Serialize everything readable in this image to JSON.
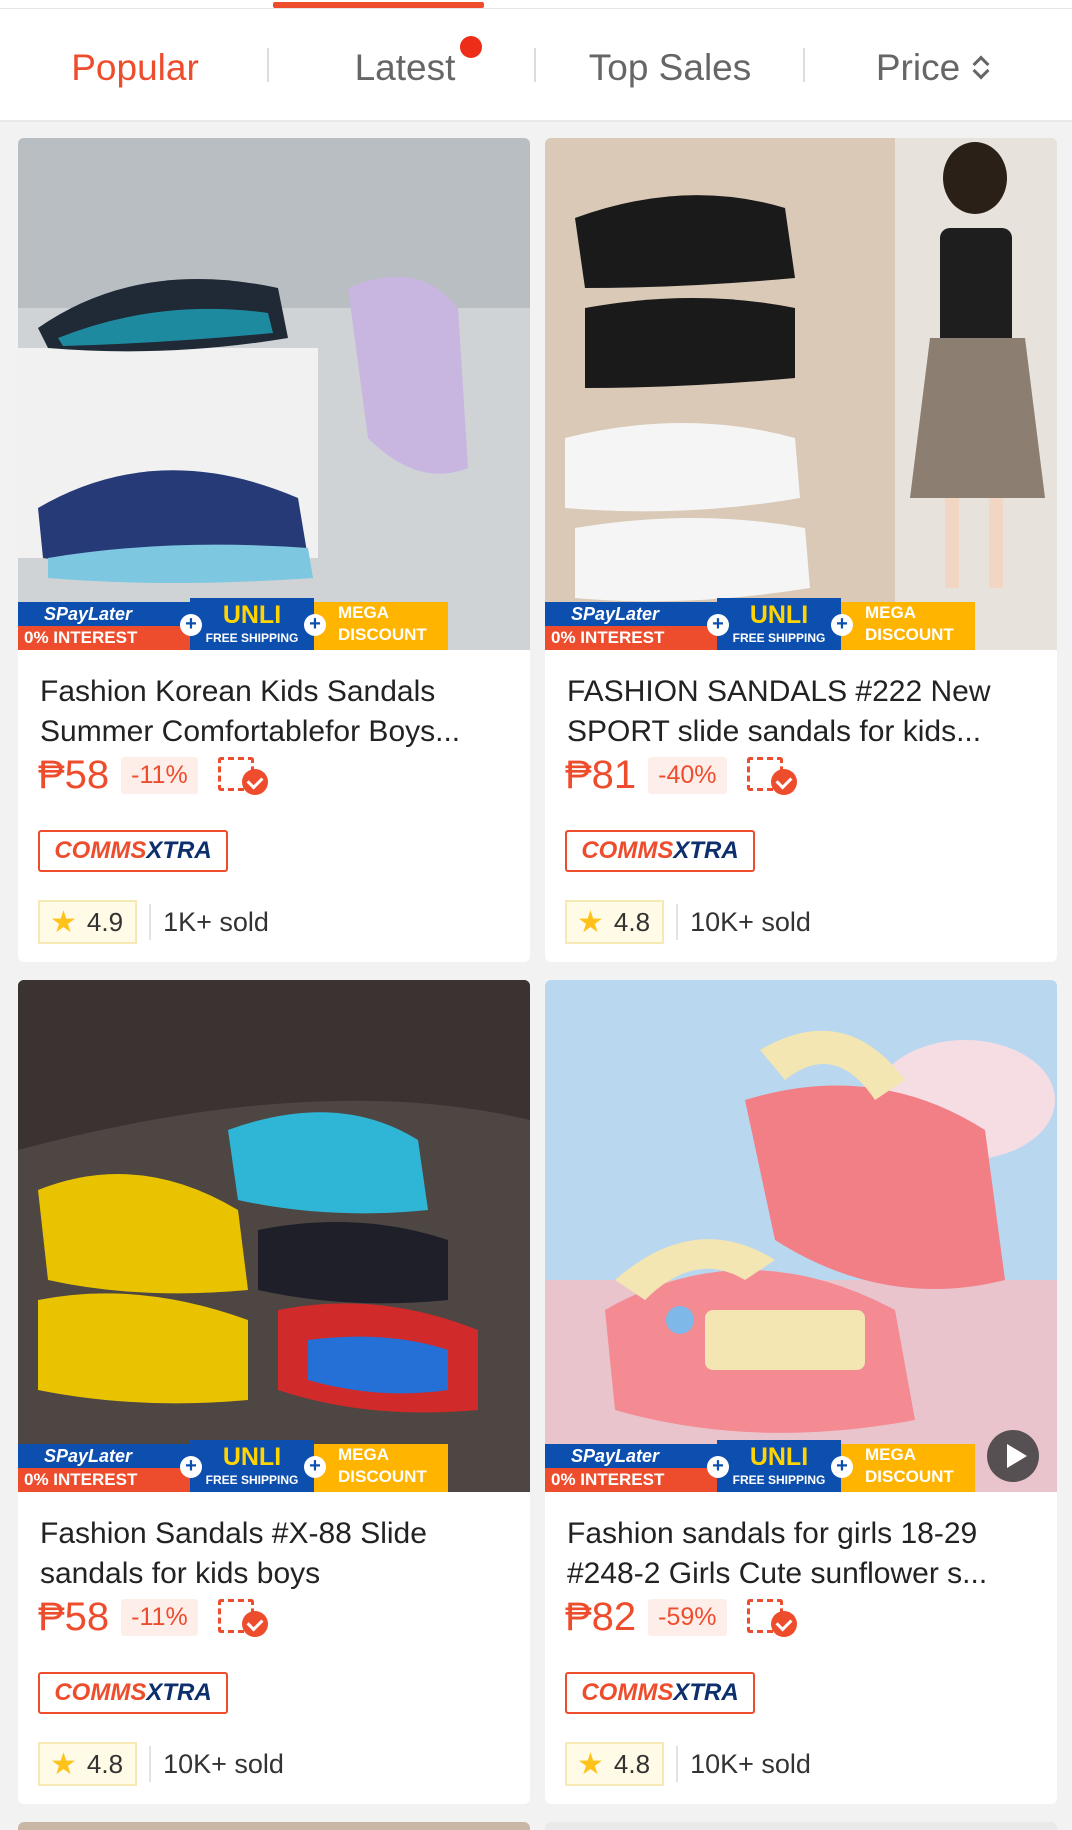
{
  "sort_tabs": {
    "popular": "Popular",
    "latest": "Latest",
    "top_sales": "Top Sales",
    "price": "Price"
  },
  "accent_color": "#ee4d2d",
  "banner": {
    "spaylater": "SPayLater",
    "interest": "0% INTEREST",
    "unli": "UNLI",
    "free_shipping": "FREE SHIPPING",
    "mega": "MEGA",
    "discount": "DISCOUNT"
  },
  "comms_badge": {
    "a": "COMMS",
    "b": "XTRA"
  },
  "products": [
    {
      "title": "Fashion Korean Kids Sandals Summer Comfortablefor Boys...",
      "price": "₱58",
      "discount": "-11%",
      "rating": "4.9",
      "sold": "1K+ sold",
      "has_video": false
    },
    {
      "title": "FASHION SANDALS #222 New SPORT  slide sandals  for kids...",
      "price": "₱81",
      "discount": "-40%",
      "rating": "4.8",
      "sold": "10K+ sold",
      "has_video": false
    },
    {
      "title": "Fashion Sandals #X-88  Slide sandals for kids boys",
      "price": "₱58",
      "discount": "-11%",
      "rating": "4.8",
      "sold": "10K+ sold",
      "has_video": false
    },
    {
      "title": "Fashion sandals for girls 18-29 #248-2 Girls Cute sunflower s...",
      "price": "₱82",
      "discount": "-59%",
      "rating": "4.8",
      "sold": "10K+ sold",
      "has_video": true
    }
  ]
}
